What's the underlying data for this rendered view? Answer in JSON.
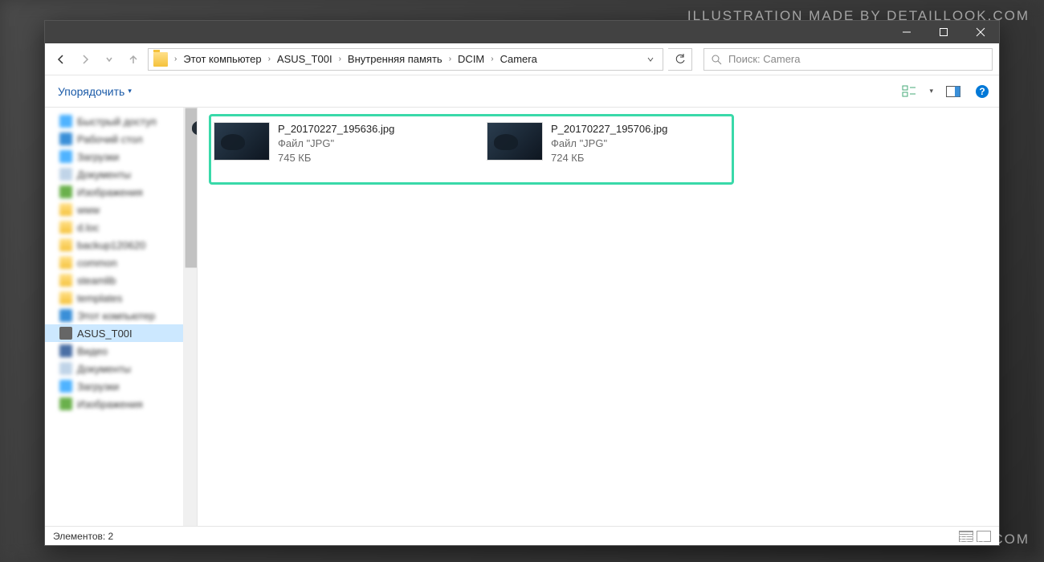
{
  "watermark": "ILLUSTRATION MADE BY DETAILLOOK.COM",
  "breadcrumbs": [
    "Этот компьютер",
    "ASUS_T00I",
    "Внутренняя память",
    "DCIM",
    "Camera"
  ],
  "search_placeholder": "Поиск: Camera",
  "toolbar": {
    "organize": "Упорядочить"
  },
  "sidebar": {
    "items": [
      {
        "label": "Быстрый доступ",
        "ico": "star"
      },
      {
        "label": "Рабочий стол",
        "ico": "desk"
      },
      {
        "label": "Загрузки",
        "ico": "down"
      },
      {
        "label": "Документы",
        "ico": "doc"
      },
      {
        "label": "Изображения",
        "ico": "img"
      },
      {
        "label": "www",
        "ico": "fold"
      },
      {
        "label": "d.loc",
        "ico": "fold"
      },
      {
        "label": "backup120620",
        "ico": "fold"
      },
      {
        "label": "common",
        "ico": "fold"
      },
      {
        "label": "steamlib",
        "ico": "fold"
      },
      {
        "label": "templates",
        "ico": "fold"
      },
      {
        "label": "Этот компьютер",
        "ico": "pc"
      },
      {
        "label": "ASUS_T00I",
        "ico": "dev",
        "selected": true
      },
      {
        "label": "Видео",
        "ico": "vid"
      },
      {
        "label": "Документы",
        "ico": "doc"
      },
      {
        "label": "Загрузки",
        "ico": "down"
      },
      {
        "label": "Изображения",
        "ico": "img"
      }
    ]
  },
  "files": [
    {
      "name": "P_20170227_195636.jpg",
      "type": "Файл \"JPG\"",
      "size": "745 КБ"
    },
    {
      "name": "P_20170227_195706.jpg",
      "type": "Файл \"JPG\"",
      "size": "724 КБ"
    }
  ],
  "status": {
    "count_label": "Элементов: 2"
  }
}
